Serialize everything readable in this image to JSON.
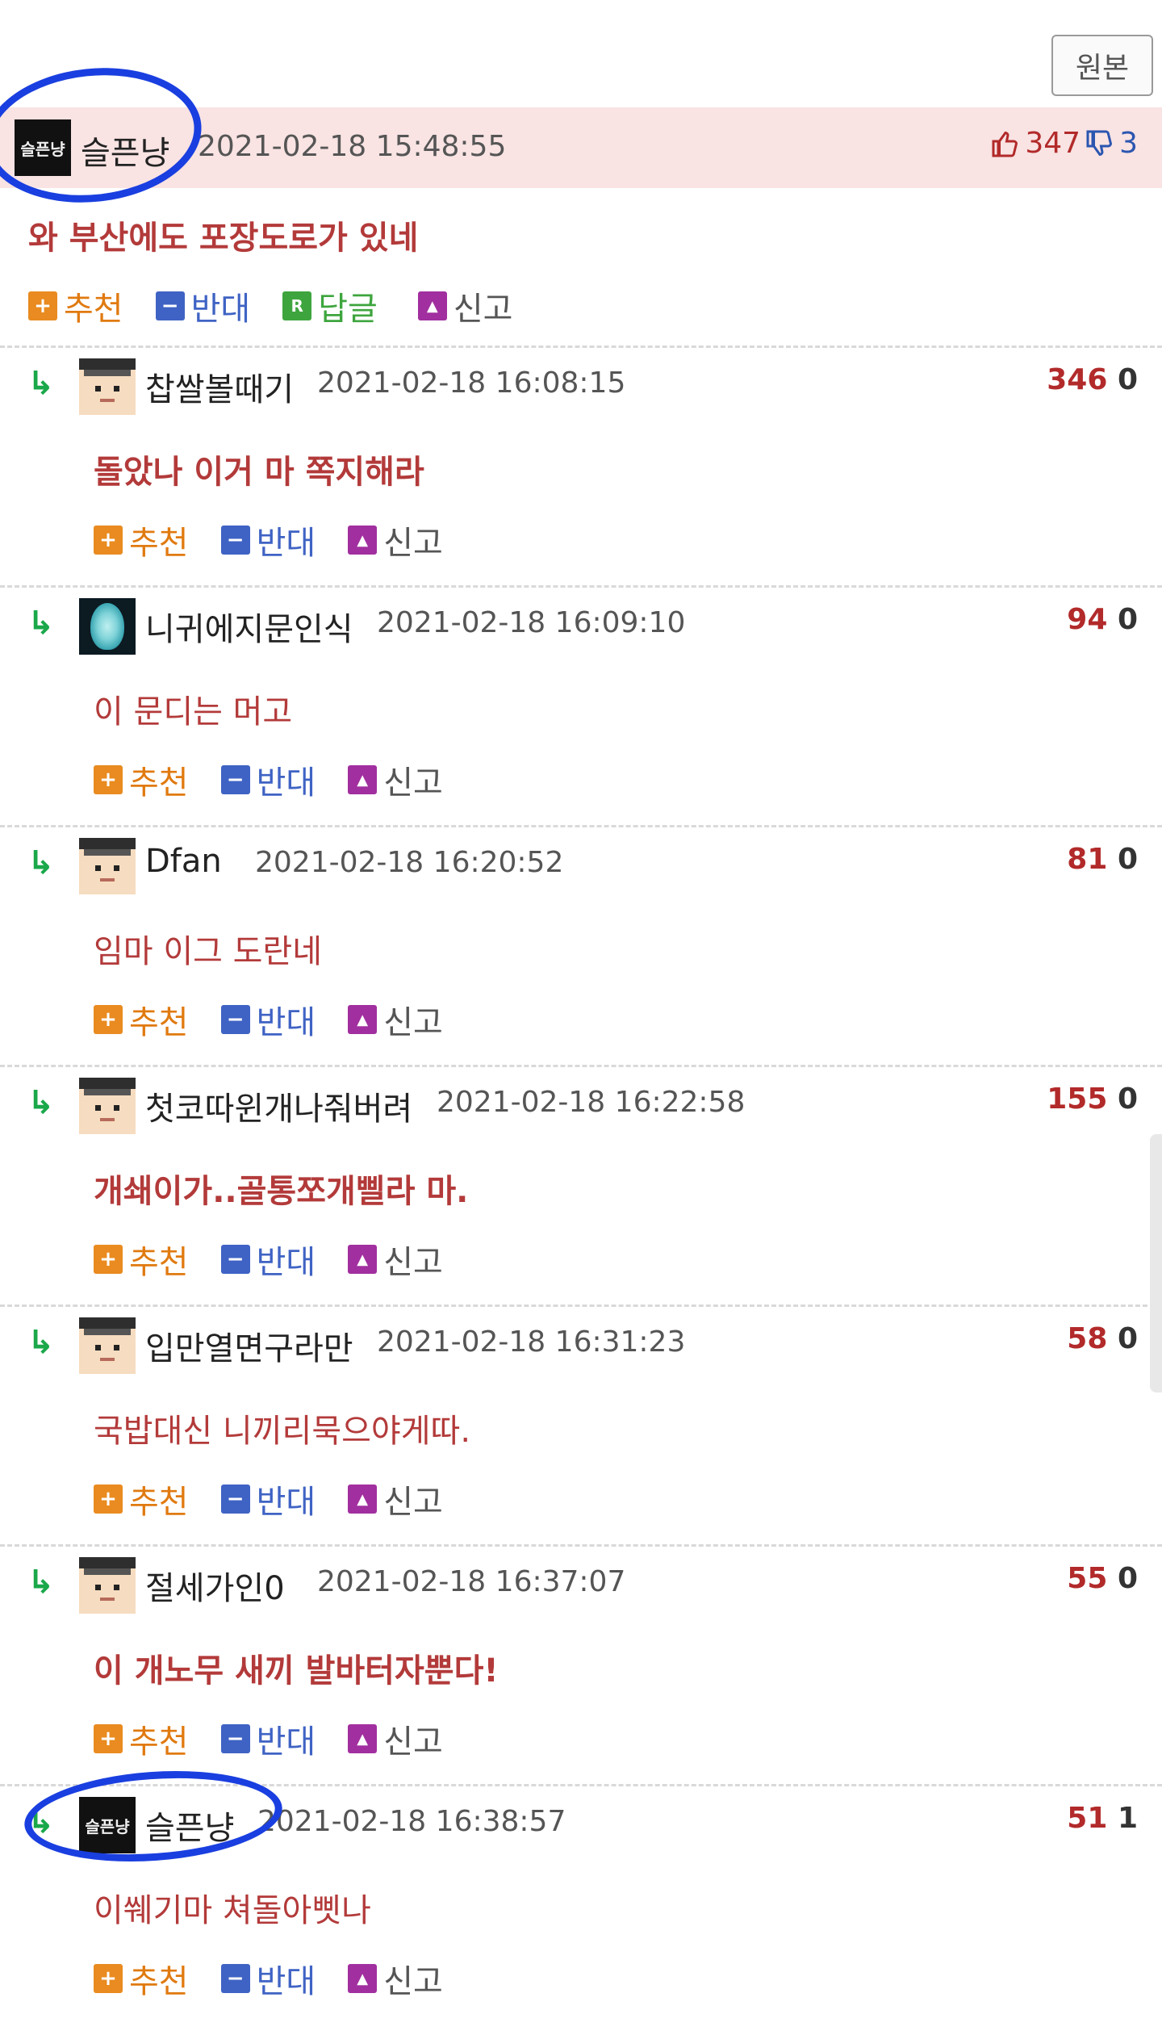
{
  "original_button": "원본",
  "top_comment": {
    "avatar_text": "슬픈냥",
    "nickname": "슬픈냥",
    "timestamp": "2021-02-18 15:48:55",
    "up": "347",
    "down": "3",
    "body": "와 부산에도 포장도로가 있네",
    "actions": {
      "recommend": "추천",
      "oppose": "반대",
      "reply_icon": "R",
      "reply": "답글",
      "report": "신고"
    }
  },
  "replies": [
    {
      "avatar": "face",
      "nickname": "찹쌀볼때기",
      "timestamp": "2021-02-18 16:08:15",
      "up": "346",
      "down": "0",
      "body": "돌았나 이거 마 쪽지해라",
      "bold": true
    },
    {
      "avatar": "finger",
      "nickname": "니귀에지문인식",
      "timestamp": "2021-02-18 16:09:10",
      "up": "94",
      "down": "0",
      "body": "이 문디는 머고",
      "bold": false
    },
    {
      "avatar": "face",
      "nickname": "Dfan",
      "timestamp": "2021-02-18 16:20:52",
      "up": "81",
      "down": "0",
      "body": "임마 이그 도란네",
      "bold": false
    },
    {
      "avatar": "face",
      "nickname": "첫코따윈개나줘버려",
      "timestamp": "2021-02-18 16:22:58",
      "up": "155",
      "down": "0",
      "body": "개쇄이가..골통쪼개삘라 마.",
      "bold": true
    },
    {
      "avatar": "face",
      "nickname": "입만열면구라만",
      "timestamp": "2021-02-18 16:31:23",
      "up": "58",
      "down": "0",
      "body": "국밥대신 니끼리묵으야게따.",
      "bold": false
    },
    {
      "avatar": "face",
      "nickname": "절세가인0",
      "timestamp": "2021-02-18 16:37:07",
      "up": "55",
      "down": "0",
      "body": "이 개노무 새끼 발바터자뿐다!",
      "bold": true
    },
    {
      "avatar": "black",
      "avatar_text": "슬픈냥",
      "nickname": "슬픈냥",
      "timestamp": "2021-02-18 16:38:57",
      "up": "51",
      "down": "1",
      "body": "이쒜기마 쳐돌아삣나",
      "bold": false
    }
  ],
  "reply_actions": {
    "recommend": "추천",
    "oppose": "반대",
    "report": "신고"
  },
  "icons": {
    "reply_arrow": "reply-arrow-icon",
    "thumb_up": "thumb-up-icon",
    "thumb_down": "thumb-down-icon",
    "plus": "plus-icon",
    "minus": "minus-icon",
    "report": "siren-icon"
  },
  "colors": {
    "accent_red": "#b22a2a",
    "recommend_orange": "#e98b20",
    "oppose_blue": "#3f63c4",
    "reply_green": "#3ea53e",
    "annotation_blue": "#1a3fe0"
  }
}
